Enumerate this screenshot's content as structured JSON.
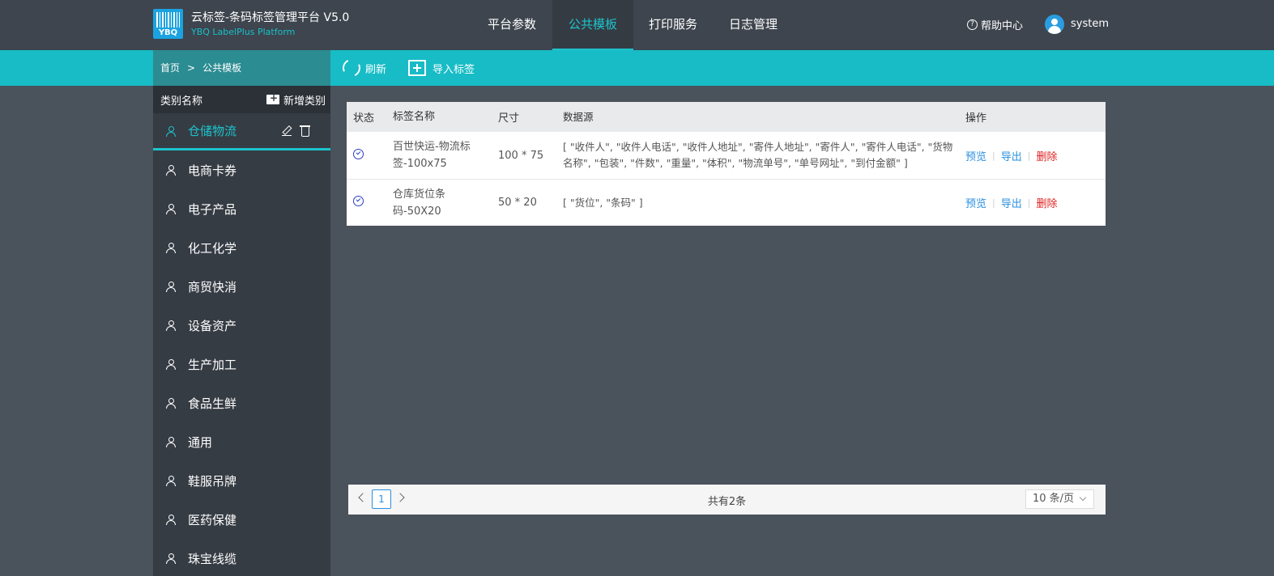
{
  "app": {
    "logo_text": "YBQ",
    "title": "云标签-条码标签管理平台 V5.0",
    "subtitle": "YBQ LabelPlus Platform"
  },
  "nav": {
    "items": [
      {
        "label": "平台参数"
      },
      {
        "label": "公共模板"
      },
      {
        "label": "打印服务"
      },
      {
        "label": "日志管理"
      }
    ],
    "help_label": "帮助中心",
    "user_name": "system"
  },
  "breadcrumb": {
    "home": "首页",
    "separator": ">",
    "current": "公共模板"
  },
  "toolbar": {
    "refresh_label": "刷新",
    "import_label": "导入标签"
  },
  "sidebar": {
    "header": "类别名称",
    "add_label": "新增类别",
    "categories": [
      {
        "label": "仓储物流"
      },
      {
        "label": "电商卡券"
      },
      {
        "label": "电子产品"
      },
      {
        "label": "化工化学"
      },
      {
        "label": "商贸快消"
      },
      {
        "label": "设备资产"
      },
      {
        "label": "生产加工"
      },
      {
        "label": "食品生鲜"
      },
      {
        "label": "通用"
      },
      {
        "label": "鞋服吊牌"
      },
      {
        "label": "医药保健"
      },
      {
        "label": "珠宝线缆"
      }
    ]
  },
  "table": {
    "headers": {
      "status": "状态",
      "name": "标签名称",
      "size": "尺寸",
      "source": "数据源",
      "ops": "操作"
    },
    "rows": [
      {
        "name": "百世快运-物流标签-100x75",
        "size": "100 * 75",
        "source": "[ \"收件人\", \"收件人电话\", \"收件人地址\", \"寄件人地址\", \"寄件人\", \"寄件人电话\", \"货物名称\", \"包装\", \"件数\", \"重量\", \"体积\", \"物流单号\", \"单号网址\", \"到付金额\" ]"
      },
      {
        "name": "仓库货位条码-50X20",
        "size": "50 * 20",
        "source": "[ \"货位\", \"条码\" ]"
      }
    ],
    "ops": {
      "preview": "预览",
      "export": "导出",
      "delete": "删除",
      "sep": "|"
    }
  },
  "pager": {
    "page": "1",
    "total": "共有2条",
    "page_size": "10 条/页"
  },
  "colors": {
    "accent": "#17bcc6",
    "nav_bg": "#3e454e",
    "sidebar_bg": "#363c44",
    "link": "#2b90e0",
    "danger": "#e02020"
  }
}
